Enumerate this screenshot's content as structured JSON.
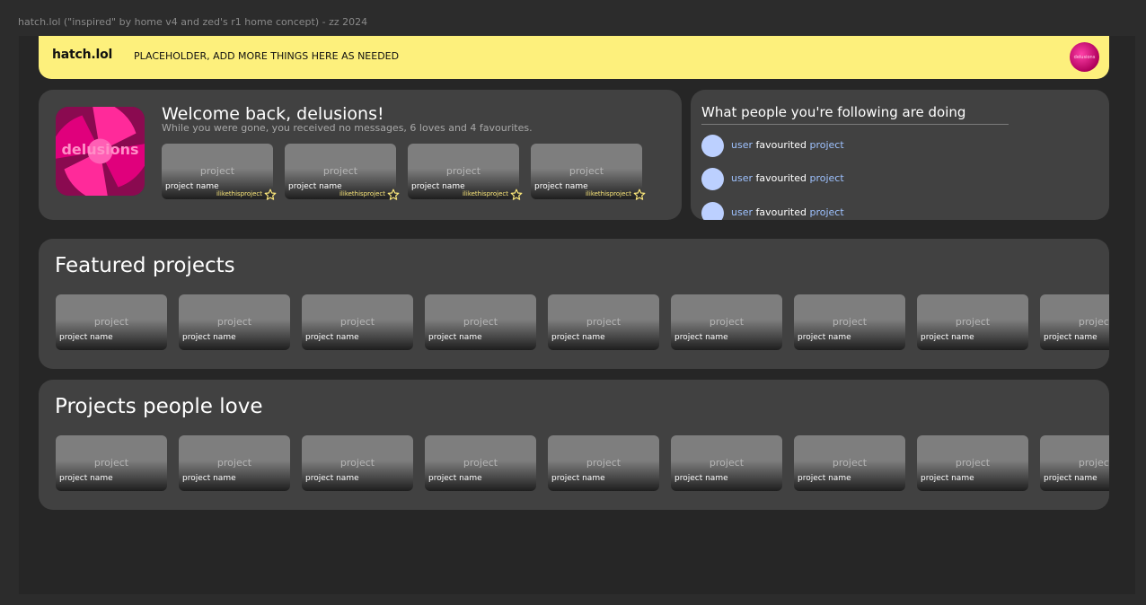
{
  "frame_title": "hatch.lol (\"inspired\" by home v4 and zed's r1 home concept) - zz 2024",
  "topbar": {
    "brand": "hatch.lol",
    "placeholder": "PLACEHOLDER, ADD MORE THINGS HERE AS NEEDED",
    "avatar_text": "delusions"
  },
  "welcome": {
    "profile_name": "delusions",
    "title": "Welcome back, delusions!",
    "subtitle": "While you were gone, you received no messages, 6 loves and 4 favourites.",
    "cards": [
      {
        "thumb": "project",
        "name": "project name",
        "by": "ilikethisproject"
      },
      {
        "thumb": "project",
        "name": "project name",
        "by": "ilikethisproject"
      },
      {
        "thumb": "project",
        "name": "project name",
        "by": "ilikethisproject"
      },
      {
        "thumb": "project",
        "name": "project name",
        "by": "ilikethisproject"
      }
    ]
  },
  "activity": {
    "title": "What people you're following are doing",
    "items": [
      {
        "user": "user",
        "action": "favourited",
        "project": "project"
      },
      {
        "user": "user",
        "action": "favourited",
        "project": "project"
      },
      {
        "user": "user",
        "action": "favourited",
        "project": "project"
      }
    ]
  },
  "featured": {
    "title": "Featured projects",
    "cards": [
      {
        "thumb": "project",
        "name": "project name"
      },
      {
        "thumb": "project",
        "name": "project name"
      },
      {
        "thumb": "project",
        "name": "project name"
      },
      {
        "thumb": "project",
        "name": "project name"
      },
      {
        "thumb": "project",
        "name": "project name"
      },
      {
        "thumb": "project",
        "name": "project name"
      },
      {
        "thumb": "project",
        "name": "project name"
      },
      {
        "thumb": "project",
        "name": "project name"
      },
      {
        "thumb": "project",
        "name": "project name"
      }
    ]
  },
  "loved": {
    "title": "Projects people love",
    "cards": [
      {
        "thumb": "project",
        "name": "project name"
      },
      {
        "thumb": "project",
        "name": "project name"
      },
      {
        "thumb": "project",
        "name": "project name"
      },
      {
        "thumb": "project",
        "name": "project name"
      },
      {
        "thumb": "project",
        "name": "project name"
      },
      {
        "thumb": "project",
        "name": "project name"
      },
      {
        "thumb": "project",
        "name": "project name"
      },
      {
        "thumb": "project",
        "name": "project name"
      },
      {
        "thumb": "project",
        "name": "project name"
      }
    ]
  },
  "colors": {
    "topbar": "#fdf07c",
    "panel": "#414141",
    "background": "#262626",
    "link": "#9ec2ff",
    "avatar_dot": "#bcd0ff",
    "author": "#fbe77a"
  },
  "icons": [
    "star-icon",
    "profile-swirl-icon"
  ]
}
